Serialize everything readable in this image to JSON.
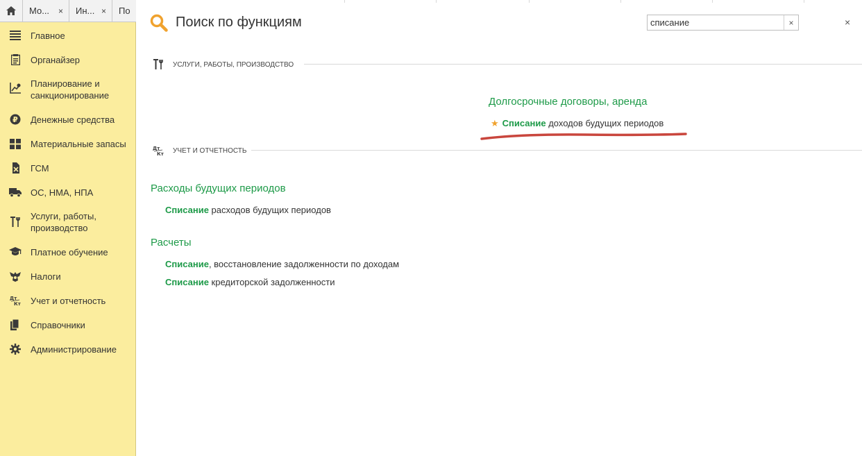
{
  "tabs": {
    "home_icon": "home-icon",
    "items": [
      {
        "label": "Мо..."
      },
      {
        "label": "Ин..."
      },
      {
        "label": "По"
      }
    ],
    "close_symbol": "×"
  },
  "sidebar": {
    "items": [
      {
        "label": "Главное",
        "icon": "menu-icon"
      },
      {
        "label": "Органайзер",
        "icon": "notes-icon"
      },
      {
        "label": "Планирование и санкционирование",
        "icon": "chart-icon"
      },
      {
        "label": "Денежные средства",
        "icon": "ruble-icon"
      },
      {
        "label": "Материальные запасы",
        "icon": "grid-icon"
      },
      {
        "label": "ГСМ",
        "icon": "fuel-icon"
      },
      {
        "label": "ОС, НМА, НПА",
        "icon": "truck-icon"
      },
      {
        "label": "Услуги, работы, производство",
        "icon": "tools-icon"
      },
      {
        "label": "Платное обучение",
        "icon": "graduation-icon"
      },
      {
        "label": "Налоги",
        "icon": "emblem-icon"
      },
      {
        "label": "Учет и отчетность",
        "icon": "dt-kt-icon"
      },
      {
        "label": "Справочники",
        "icon": "books-icon"
      },
      {
        "label": "Администрирование",
        "icon": "gear-icon"
      }
    ]
  },
  "header": {
    "title": "Поиск по функциям",
    "search_value": "списание",
    "clear_symbol": "×",
    "close_symbol": "×"
  },
  "sections": [
    {
      "title": "УСЛУГИ, РАБОТЫ, ПРОИЗВОДСТВО",
      "icon": "tools-icon",
      "groups": [
        {
          "title": "Долгосрочные договоры, аренда",
          "results": [
            {
              "highlight": "Списание",
              "rest": " доходов будущих периодов",
              "starred": true
            }
          ]
        }
      ]
    },
    {
      "title": "УЧЕТ И ОТЧЕТНОСТЬ",
      "icon": "dt-kt-icon",
      "groups": [
        {
          "title": "Расходы будущих периодов",
          "results": [
            {
              "highlight": "Списание",
              "rest": " расходов будущих периодов"
            }
          ]
        },
        {
          "title": "Расчеты",
          "results": [
            {
              "highlight": "Списание",
              "rest": ", восстановление задолженности по доходам"
            },
            {
              "highlight": "Списание",
              "rest": " кредиторской задолженности"
            }
          ]
        }
      ]
    }
  ],
  "colors": {
    "sidebar_bg": "#fbed9e",
    "accent_green": "#1d9a48",
    "star": "#f0a22e",
    "annotation_red": "#c9463d"
  }
}
